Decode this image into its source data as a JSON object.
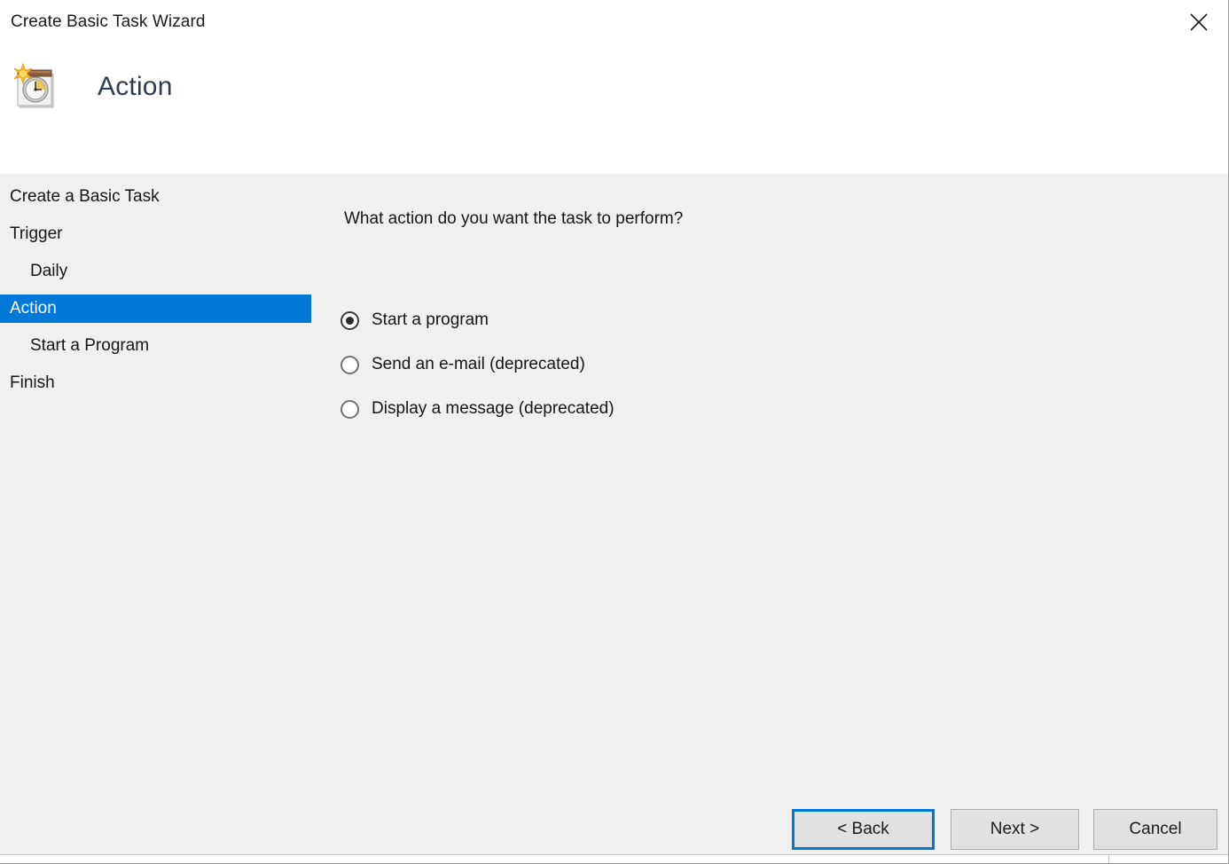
{
  "window": {
    "title": "Create Basic Task Wizard",
    "close_icon": "close-icon"
  },
  "header": {
    "icon": "task-scheduler-wizard-icon",
    "heading": "Action"
  },
  "sidebar": {
    "items": [
      {
        "label": "Create a Basic Task",
        "level": 0,
        "selected": false
      },
      {
        "label": "Trigger",
        "level": 0,
        "selected": false
      },
      {
        "label": "Daily",
        "level": 1,
        "selected": false
      },
      {
        "label": "Action",
        "level": 0,
        "selected": true
      },
      {
        "label": "Start a Program",
        "level": 1,
        "selected": false
      },
      {
        "label": "Finish",
        "level": 0,
        "selected": false
      }
    ]
  },
  "main": {
    "question": "What action do you want the task to perform?",
    "options": [
      {
        "label": "Start a program",
        "checked": true
      },
      {
        "label": "Send an e-mail (deprecated)",
        "checked": false
      },
      {
        "label": "Display a message (deprecated)",
        "checked": false
      }
    ]
  },
  "footer": {
    "back_label": "< Back",
    "next_label": "Next >",
    "cancel_label": "Cancel"
  },
  "colors": {
    "accent": "#0078d7",
    "body_background": "#f0f0f0",
    "header_background": "#ffffff",
    "button_face": "#e1e1e1",
    "heading_text": "#2f3d4f"
  }
}
